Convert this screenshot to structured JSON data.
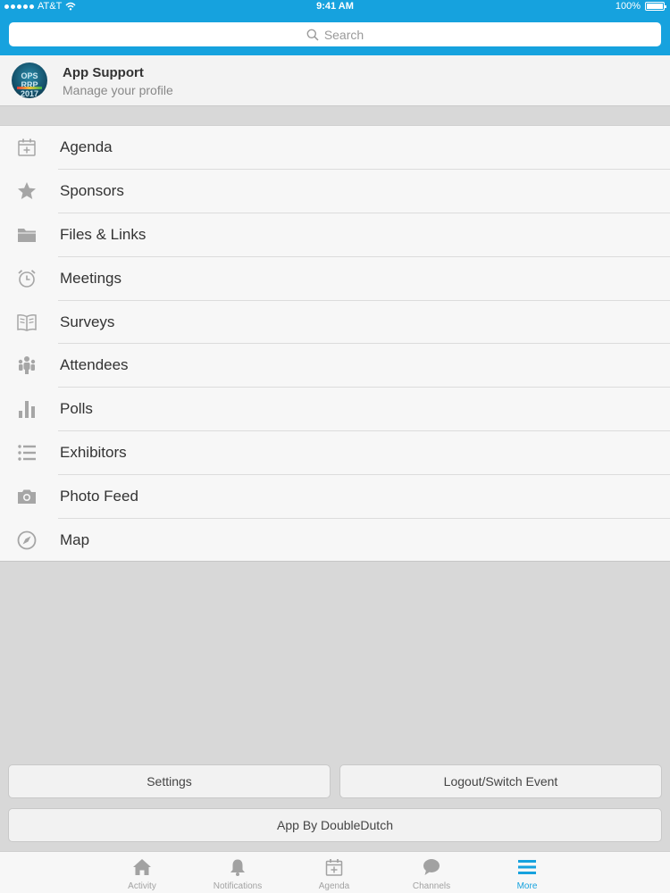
{
  "status_bar": {
    "carrier": "AT&T",
    "time": "9:41 AM",
    "battery": "100%"
  },
  "search": {
    "placeholder": "Search"
  },
  "profile": {
    "avatar_text": "OPS RRP 2017",
    "name": "App Support",
    "subtitle": "Manage your profile"
  },
  "menu": [
    {
      "label": "Agenda",
      "icon": "calendar-plus-icon"
    },
    {
      "label": "Sponsors",
      "icon": "star-icon"
    },
    {
      "label": "Files & Links",
      "icon": "folder-icon"
    },
    {
      "label": "Meetings",
      "icon": "alarm-clock-icon"
    },
    {
      "label": "Surveys",
      "icon": "open-book-icon"
    },
    {
      "label": "Attendees",
      "icon": "people-icon"
    },
    {
      "label": "Polls",
      "icon": "bar-chart-icon"
    },
    {
      "label": "Exhibitors",
      "icon": "list-icon"
    },
    {
      "label": "Photo Feed",
      "icon": "camera-icon"
    },
    {
      "label": "Map",
      "icon": "compass-icon"
    }
  ],
  "buttons": {
    "settings": "Settings",
    "logout": "Logout/Switch Event",
    "app_by": "App By DoubleDutch"
  },
  "tabs": [
    {
      "label": "Activity",
      "icon": "home-icon"
    },
    {
      "label": "Notifications",
      "icon": "bell-icon"
    },
    {
      "label": "Agenda",
      "icon": "calendar-plus-icon"
    },
    {
      "label": "Channels",
      "icon": "chat-bubble-icon"
    },
    {
      "label": "More",
      "icon": "hamburger-menu-icon",
      "active": true
    }
  ],
  "colors": {
    "accent": "#16a2de",
    "icon_gray": "#a6a6a6"
  }
}
